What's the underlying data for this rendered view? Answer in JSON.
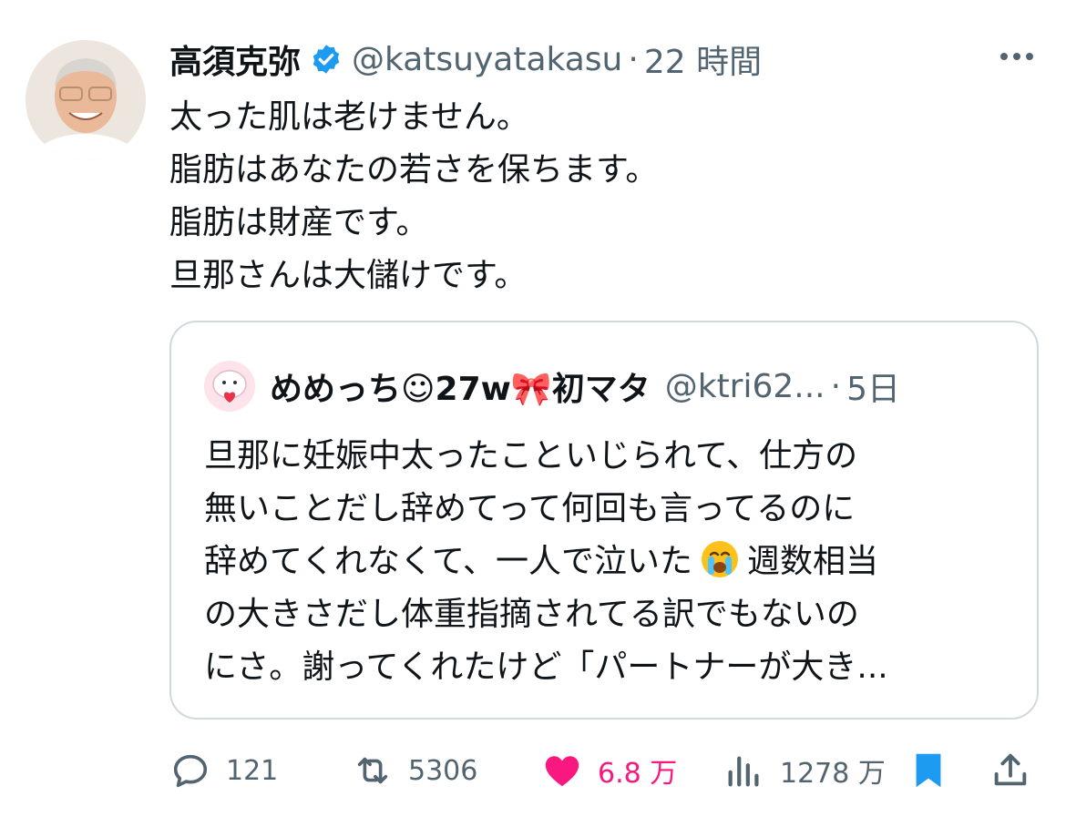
{
  "tweet": {
    "author_name": "高須克弥",
    "handle": "@katsuyatakasu",
    "separator": "·",
    "time": "22 時間",
    "lines": [
      "太った肌は老けません。",
      "脂肪はあなたの若さを保ちます。",
      "脂肪は財産です。",
      "旦那さんは大儲けです。"
    ]
  },
  "quote": {
    "author_name": "めめっち☺27w🎀初マタ",
    "handle": "@ktri62...",
    "separator": "·",
    "time": "5日",
    "line1": "旦那に妊娠中太ったこといじられて、仕方の",
    "line2": "無いことだし辞めてって何回も言ってるのに",
    "line3a": "辞めてくれなくて、一人で泣いた",
    "line3b": "週数相当",
    "line4": "の大きさだし体重指摘されてる訳でもないの",
    "line5": "にさ。謝ってくれたけど「パートナーが大き..."
  },
  "actions": {
    "replies": "121",
    "retweets": "5306",
    "likes": "6.8 万",
    "views": "1278 万"
  },
  "icons": {
    "verified": "verified-badge-icon",
    "more": "more-dots-icon",
    "reply": "reply-icon",
    "retweet": "retweet-icon",
    "like": "heart-icon",
    "views": "views-icon",
    "bookmark": "bookmark-icon",
    "share": "share-icon",
    "emoji": "crying-face-icon"
  },
  "colors": {
    "verified": "#1d9bf0",
    "like": "#f91880",
    "bookmark": "#1d9bf0",
    "secondary": "#536471"
  }
}
